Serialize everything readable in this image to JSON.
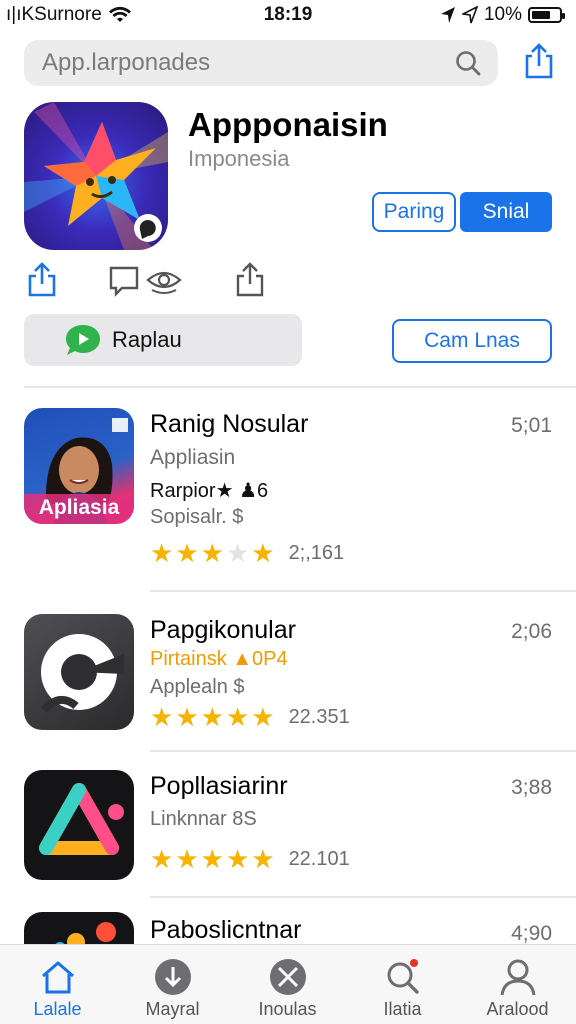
{
  "status": {
    "carrier": "ı|ıKSurnore",
    "time": "18:19",
    "battery": "10%",
    "battery_level": 0.7
  },
  "search": {
    "placeholder": "App.larponades"
  },
  "app": {
    "title": "Appponaisin",
    "subtitle": "Imponesia",
    "button_secondary": "Paring",
    "button_primary": "Snial",
    "replay_label": "Raplau",
    "outline_button": "Cam Lnas"
  },
  "list": [
    {
      "title": "Ranig Nosular",
      "time": "5;01",
      "line1": "Appliasin",
      "line2": "Rarpior★ ♟6",
      "line3": "Sopisalr. $",
      "rating": 3.5,
      "count": "2;,161",
      "thumb_label": "Apliasia"
    },
    {
      "title": "Papgikonular",
      "time": "2;06",
      "line1": "Pirtainsk ▲0P4",
      "line2": "Applealn $",
      "rating": 5,
      "count": "22.351"
    },
    {
      "title": "Popllasiarinr",
      "time": "3;88",
      "line1": "Linknnar 8S",
      "rating": 5,
      "count": "22.101"
    },
    {
      "title": "Pabosliсntnar",
      "time": "4;90"
    }
  ],
  "tabs": [
    {
      "label": "Lalale",
      "icon": "home-icon",
      "active": true
    },
    {
      "label": "Mayral",
      "icon": "download-icon"
    },
    {
      "label": "Inoulas",
      "icon": "close-circle-icon"
    },
    {
      "label": "Ilatia",
      "icon": "search-icon"
    },
    {
      "label": "Aralood",
      "icon": "profile-icon"
    }
  ],
  "colors": {
    "accent": "#1a73e8",
    "star": "#f6b400",
    "orange": "#f09b00"
  }
}
